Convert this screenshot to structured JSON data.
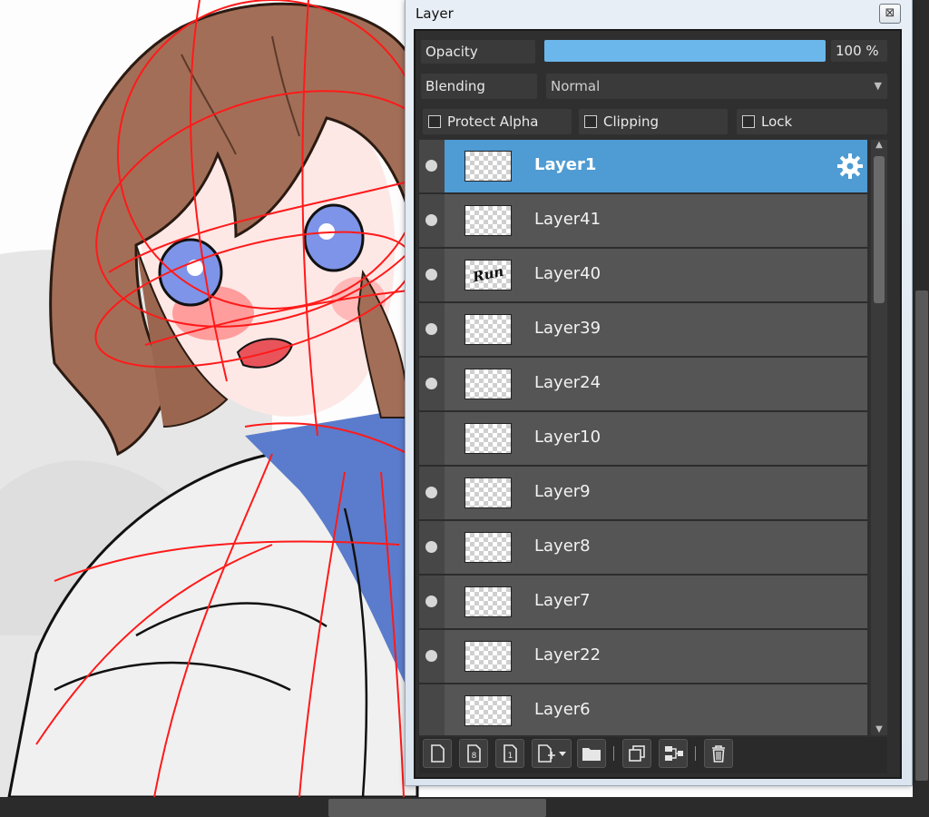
{
  "layer_panel": {
    "title": "Layer",
    "close_glyph": "⊠",
    "opacity": {
      "label": "Opacity",
      "value": 1.0,
      "value_text": "100 %"
    },
    "blending": {
      "label": "Blending",
      "value": "Normal"
    },
    "checkboxes": {
      "protect_alpha": {
        "label": "Protect Alpha",
        "checked": false
      },
      "clipping": {
        "label": "Clipping",
        "checked": false
      },
      "lock": {
        "label": "Lock",
        "checked": false
      }
    },
    "layers": [
      {
        "name": "Layer1",
        "visible": true,
        "selected": true
      },
      {
        "name": "Layer41",
        "visible": true,
        "selected": false
      },
      {
        "name": "Layer40",
        "visible": true,
        "selected": false,
        "thumb_text": "Run"
      },
      {
        "name": "Layer39",
        "visible": true,
        "selected": false
      },
      {
        "name": "Layer24",
        "visible": true,
        "selected": false
      },
      {
        "name": "Layer10",
        "visible": false,
        "selected": false
      },
      {
        "name": "Layer9",
        "visible": true,
        "selected": false
      },
      {
        "name": "Layer8",
        "visible": true,
        "selected": false
      },
      {
        "name": "Layer7",
        "visible": true,
        "selected": false
      },
      {
        "name": "Layer22",
        "visible": true,
        "selected": false
      },
      {
        "name": "Layer6",
        "visible": false,
        "selected": false
      }
    ],
    "toolbar_icons": [
      "new-layer-icon",
      "new-8bit-layer-icon",
      "new-1bit-layer-icon",
      "add-layer-dropdown-icon",
      "new-folder-icon",
      "duplicate-layer-icon",
      "merge-down-icon",
      "delete-layer-icon"
    ],
    "colors": {
      "selected_row": "#4f9bd3",
      "row": "#555555",
      "opacity_fill": "#6bb6ea",
      "sketch_lines": "#ff1a1a"
    }
  }
}
